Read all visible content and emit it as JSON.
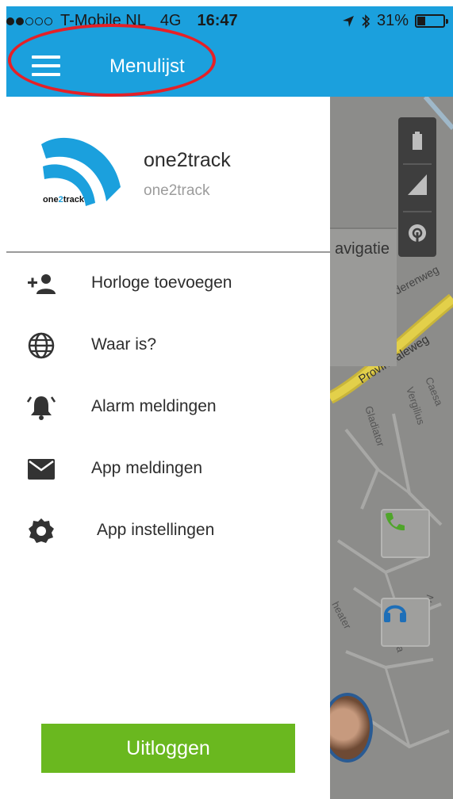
{
  "status_bar": {
    "carrier": "T-Mobile NL",
    "network": "4G",
    "time": "16:47",
    "battery_percent": "31%",
    "battery_level": 0.31,
    "signal_bars_filled": 2,
    "signal_bars_total": 5
  },
  "header": {
    "title": "Menulijst",
    "menu_icon": "hamburger-icon",
    "background_color": "#1ba0dd",
    "annotation_color": "#e52027"
  },
  "profile": {
    "name": "one2track",
    "subtitle": "one2track",
    "logo_text_prefix": "one",
    "logo_text_accent": "2",
    "logo_text_suffix": "track"
  },
  "menu": {
    "items": [
      {
        "label": "Horloge toevoegen",
        "icon": "add-person-icon"
      },
      {
        "label": "Waar is?",
        "icon": "globe-icon"
      },
      {
        "label": "Alarm meldingen",
        "icon": "alarm-bell-icon"
      },
      {
        "label": "App meldingen",
        "icon": "envelope-icon"
      },
      {
        "label": "App instellingen",
        "icon": "gear-icon"
      }
    ]
  },
  "logout": {
    "label": "Uitloggen",
    "color": "#6ab81f"
  },
  "map": {
    "nav_label": "avigatie",
    "streets": [
      "derenweg",
      "Provincialeweg",
      "Caesa",
      "Vergilius",
      "Gladiator",
      "heater",
      "ssa",
      "Via N"
    ]
  }
}
